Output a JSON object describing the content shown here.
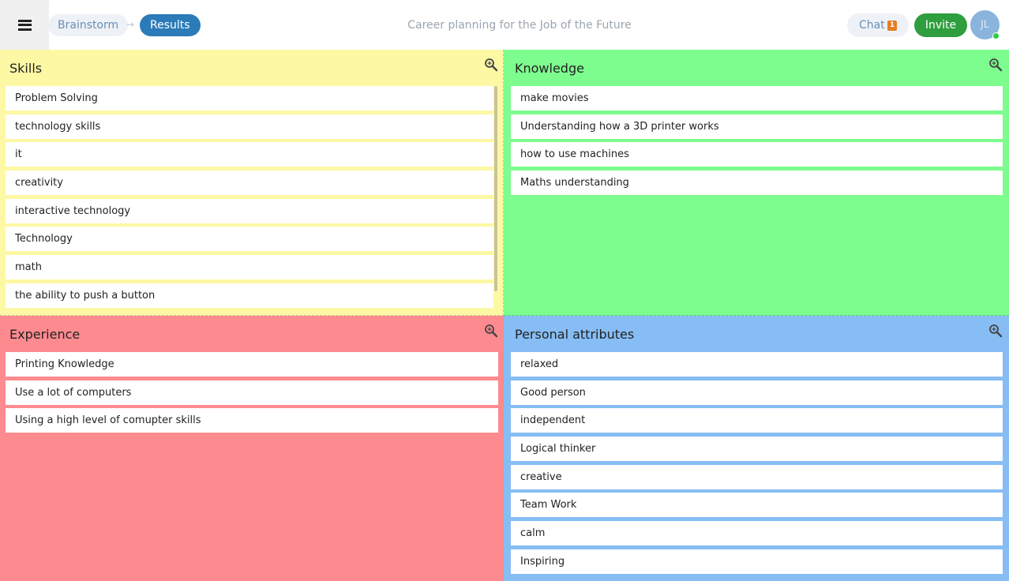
{
  "header": {
    "menu_icon": "hamburger-menu-icon",
    "breadcrumb": {
      "brainstorm": "Brainstorm",
      "arrow": "→",
      "results": "Results"
    },
    "title": "Career planning for the Job of the Future",
    "chat": {
      "label": "Chat",
      "badge": "1"
    },
    "invite_label": "Invite",
    "avatar_initials": "JL"
  },
  "colors": {
    "skills": "#fdf8a4",
    "knowledge": "#7dfd8e",
    "experience": "#fd8a8f",
    "personal": "#86bdf4",
    "accent": "#2b7bb9",
    "invite": "#2e9e3e",
    "badge": "#e67e22"
  },
  "quadrants": {
    "skills": {
      "title": "Skills",
      "icon": "zoom-icon",
      "items": [
        "Problem Solving",
        "technology skills",
        "it",
        "creativity",
        "interactive technology",
        "Technology",
        "math",
        "the ability to push a button"
      ]
    },
    "knowledge": {
      "title": "Knowledge",
      "icon": "zoom-icon",
      "items": [
        "make movies",
        "Understanding how a 3D printer works",
        "how to use machines",
        "Maths understanding"
      ]
    },
    "experience": {
      "title": "Experience",
      "icon": "zoom-icon",
      "items": [
        "Printing Knowledge",
        "Use a lot of computers",
        "Using a high level of comupter skills"
      ]
    },
    "personal": {
      "title": "Personal attributes",
      "icon": "zoom-icon",
      "items": [
        "relaxed",
        "Good person",
        "independent",
        "Logical thinker",
        "creative",
        "Team Work",
        "calm",
        "Inspiring"
      ]
    }
  }
}
